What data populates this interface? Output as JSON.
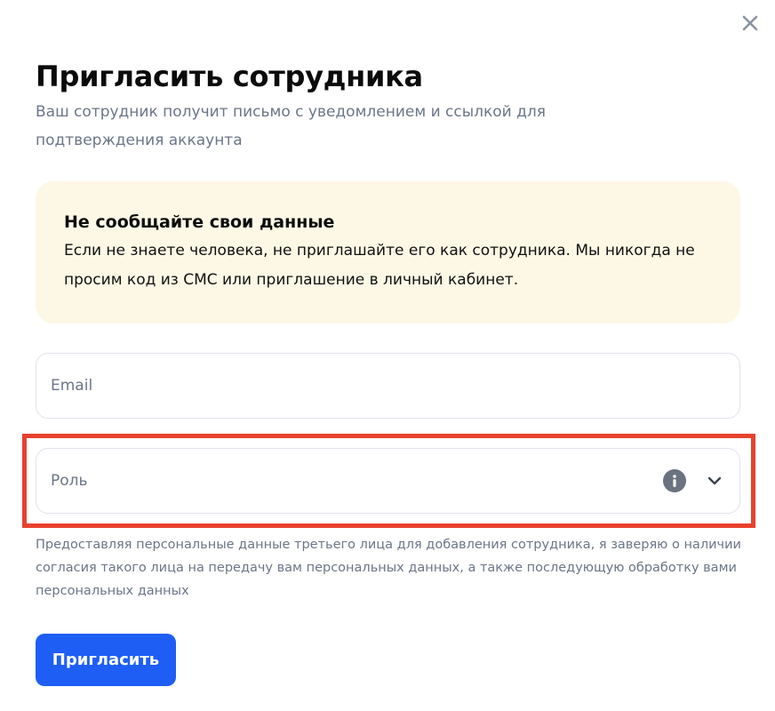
{
  "modal": {
    "title": "Пригласить сотрудника",
    "subtitle": "Ваш сотрудник получит письмо с уведомлением и ссылкой для подтверждения аккаунта",
    "close_icon": "close-icon"
  },
  "warning": {
    "title": "Не сообщайте свои данные",
    "text": "Если не знаете человека, не приглашайте его как сотрудника. Мы никогда не просим код из СМС или приглашение в личный кабинет.",
    "background": "#fcf8e5"
  },
  "form": {
    "email_placeholder": "Email",
    "role_placeholder": "Роль",
    "role_info_icon": "info-icon",
    "role_chevron_icon": "chevron-down-icon"
  },
  "consent_text": "Предоставляя персональные данные третьего лица для добавления сотрудника, я заверяю о наличии согласия такого лица на передачу вам персональных данных, а также последующую обработку вами персональных данных",
  "actions": {
    "invite_label": "Пригласить"
  },
  "colors": {
    "accent": "#1e5ef5",
    "highlight": "#e8412f",
    "muted_text": "#6b7689"
  }
}
